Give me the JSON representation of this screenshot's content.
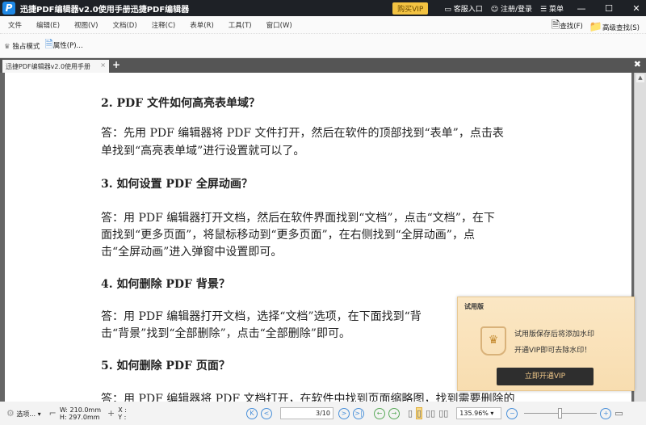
{
  "app": {
    "title": "迅捷PDF编辑器v2.0使用手册迅捷PDF编辑器",
    "logo": "P"
  },
  "titlebar": {
    "buy_vip": "购买VIP",
    "support": "客服入口",
    "login": "注册/登录",
    "menu": "菜单"
  },
  "menu": [
    "文件",
    "编辑(E)",
    "视图(V)",
    "文档(D)",
    "注释(C)",
    "表单(R)",
    "工具(T)",
    "窗口(W)"
  ],
  "search": {
    "find": "查找(F)",
    "advanced_find": "高级查找(S)"
  },
  "toolbar": {
    "exclusive_mode": "独占模式",
    "properties": "属性(P)..."
  },
  "tab": {
    "label": "迅捷PDF编辑器v2.0使用手册",
    "close": "×",
    "add": "+"
  },
  "document": {
    "lines": [
      "2. PDF 文件如何高亮表单域？",
      "答：先用 PDF 编辑器将 PDF 文件打开，然后在软件的顶部找到“表单”，点击表",
      "单找到“高亮表单域”进行设置就可以了。",
      "3. 如何设置 PDF 全屏动画？",
      "答：用 PDF 编辑器打开文档，然后在软件界面找到“文档”，点击“文档”，在下",
      "面找到“更多页面”，将鼠标移动到“更多页面”，在右侧找到“全屏动画”，点",
      "击“全屏动画”进入弹窗中设置即可。",
      "4. 如何删除 PDF 背景？",
      "答：用 PDF 编辑器打开文档，选择“文档”选项，在下面找到“背",
      "击“背景”找到“全部删除”，点击“全部删除”即可。",
      "5. 如何删除 PDF 页面？",
      "答：用 PDF 编辑器将 PDF 文档打开，在软件中找到页面缩略图，找到需要删除的"
    ]
  },
  "popup": {
    "title": "试用版",
    "msg1": "试用版保存后将添加水印",
    "msg2": "开通VIP即可去除水印！",
    "button": "立即开通VIP"
  },
  "status": {
    "options": "选项...",
    "width": "W: 210.0mm",
    "height": "H: 297.0mm",
    "x": "X :",
    "y": "Y :",
    "page": "3/10",
    "zoom": "135.96%"
  },
  "colors": {
    "titlebar": "#1e2126",
    "vip": "#f3c342",
    "accent": "#4a90d9"
  }
}
